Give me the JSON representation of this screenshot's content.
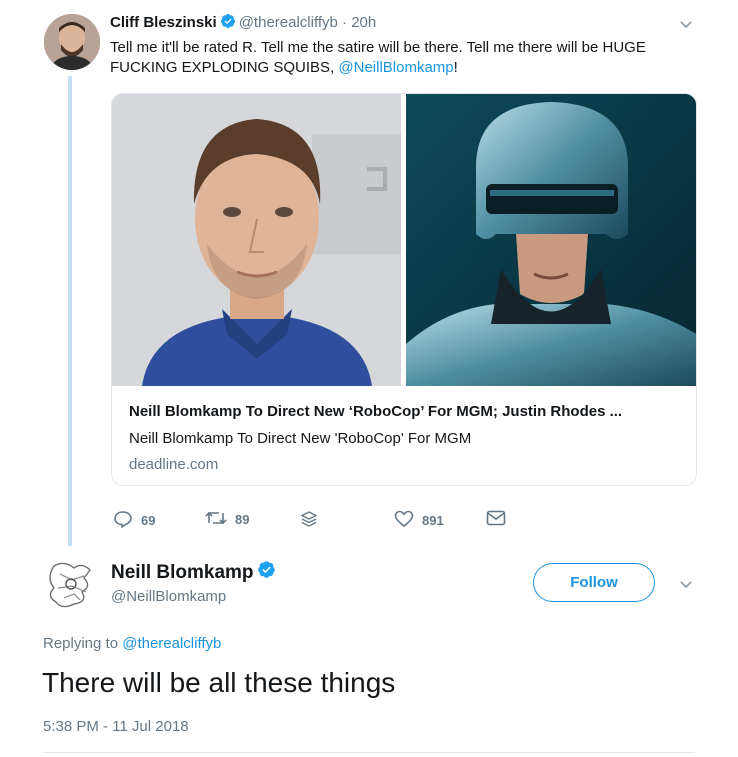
{
  "parent_tweet": {
    "author_name": "Cliff Bleszinski",
    "author_handle": "@therealcliffyb",
    "separator": " · ",
    "time": "20h",
    "text": "Tell me it'll be rated R. Tell me the satire will be there. Tell me there will be HUGE FUCKING EXPLODING SQUIBS, ",
    "mention": "@NeillBlomkamp",
    "text_end": "!",
    "card": {
      "title": "Neill Blomkamp To Direct New ‘RoboCop’ For MGM; Justin Rhodes ...",
      "description": "Neill Blomkamp To Direct New 'RoboCop' For MGM",
      "domain": "deadline.com"
    },
    "actions": {
      "replies": "69",
      "retweets": "89",
      "likes": "891"
    }
  },
  "reply_tweet": {
    "author_name": "Neill Blomkamp",
    "author_handle": "@NeillBlomkamp",
    "follow_label": "Follow",
    "replying_prefix": "Replying to ",
    "replying_to": "@therealcliffyb",
    "text": "There will be all these things",
    "timestamp": "5:38 PM - 11 Jul 2018"
  },
  "colors": {
    "link": "#1b95e0",
    "muted": "#657786",
    "thread_line": "#c4e0f5",
    "verified": "#1da1f2"
  },
  "icons": [
    "verified-badge-icon",
    "chevron-down-icon",
    "reply-icon",
    "retweet-icon",
    "stack-icon",
    "heart-icon",
    "envelope-icon"
  ]
}
